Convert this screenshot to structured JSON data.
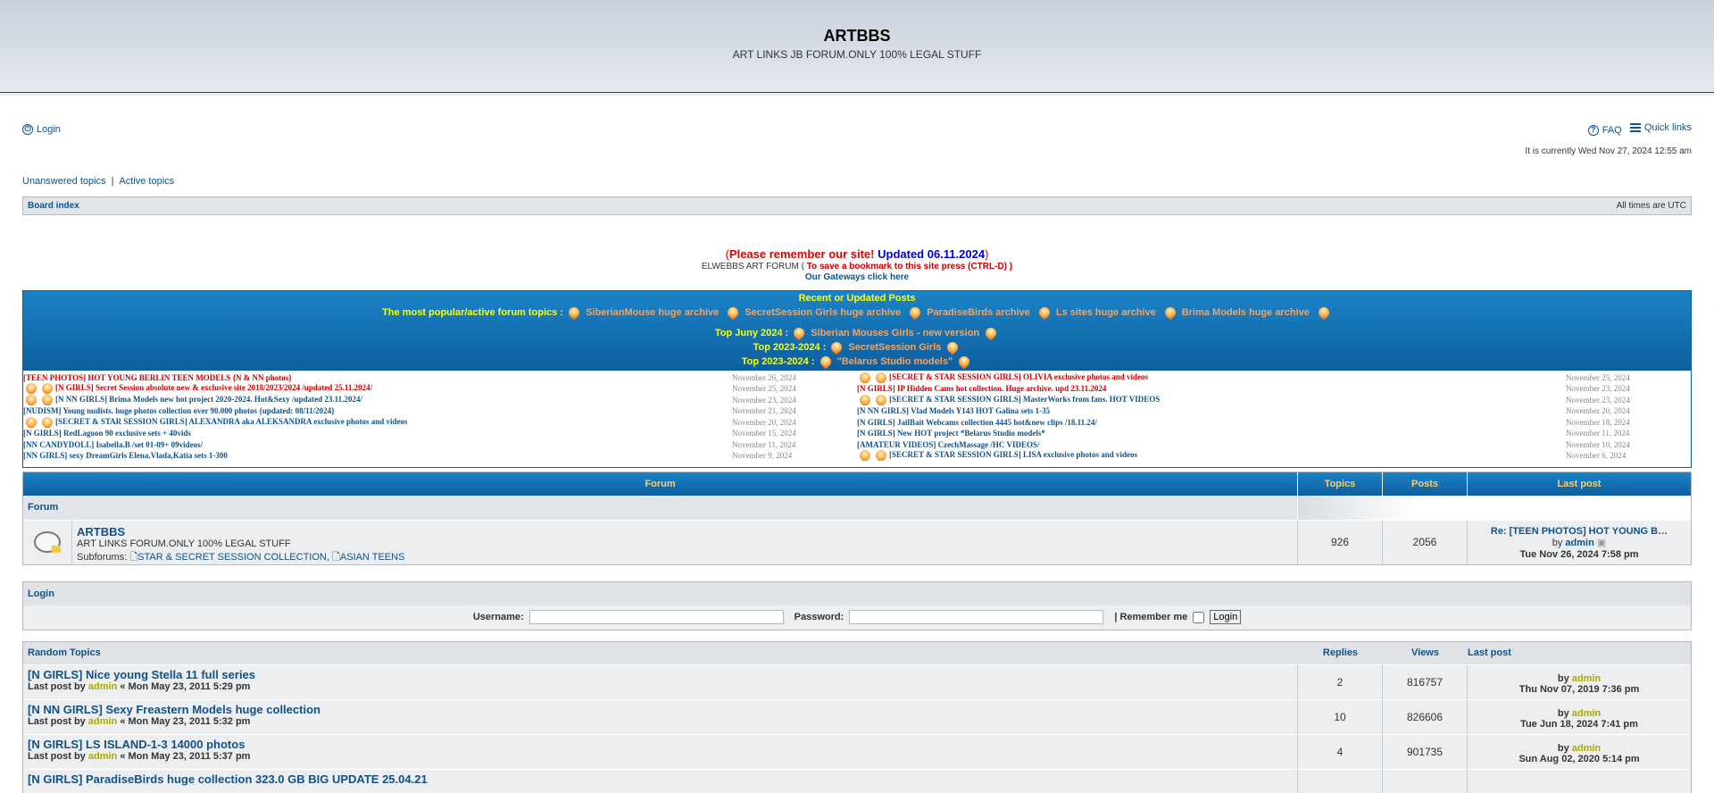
{
  "header": {
    "title": "ARTBBS",
    "subtitle": "ART LINKS JB FORUM.ONLY 100% LEGAL STUFF"
  },
  "nav": {
    "login": "Login",
    "faq": "FAQ",
    "quick_links": "Quick links"
  },
  "time_text": "It is currently Wed Nov 27, 2024 12:55 am",
  "links": {
    "unanswered": "Unanswered topics",
    "sep": "|",
    "active": "Active topics"
  },
  "breadcrumb": {
    "board_index": "Board index",
    "timezone": "All times are UTC"
  },
  "notice": {
    "open": "(",
    "remember": "Please remember our site!",
    "updated": "Updated 06.11.2024",
    "close": ")",
    "bookmark_prefix": "ELWEBBS ART FORUM (",
    "bookmark": "To save a bookmark to this site press (CTRL-D)",
    "bookmark_close": ")",
    "gateways": "Our Gateways click here"
  },
  "popular": {
    "title": "Recent or Updated Posts",
    "label": "The most popular/active forum topics :",
    "archives": [
      "SiberianMouse huge archive",
      "SecretSession Girls huge archive",
      "ParadiseBirds archive",
      "Ls sites huge archive",
      "Brima Models huge archive"
    ],
    "top1_label": "Top Juny 2024 :",
    "top1": "Siberian Mouses Girls - new version",
    "top2_label": "Top 2023-2024 :",
    "top2": "SecretSession Girls",
    "top3_label": "Top 2023-2024 :",
    "top3": "\"Belarus Studio models\""
  },
  "recent_left": [
    {
      "t": "[TEEN PHOTOS] HOT YOUNG BERLIN TEEN MODELS {N & NN photos}",
      "d": "November 26, 2024",
      "red": true
    },
    {
      "t": "[N GIRLS] Secret Session absolute new & exclusive site 2018/2023/2024 /updated 25.11.2024/",
      "d": "November 25, 2024",
      "red": true
    },
    {
      "t": "[N NN GIRLS] Brima Models new hot project 2020-2024. Hot&Sexy /updated 23.11.2024/",
      "d": "November 23, 2024",
      "red": false
    },
    {
      "t": "[NUDISM] Young nudists. huge photos collection over 90.000 photos {updated: 08/11/2024}",
      "d": "November 21, 2024",
      "red": false
    },
    {
      "t": "[SECRET & STAR SESSION GIRLS] ALEXANDRA aka ALEKSANDRA exclusive photos and videos",
      "d": "November 20, 2024",
      "red": false
    },
    {
      "t": "[N GIRLS] RedLagoon 90 exclusive sets + 40vids",
      "d": "November 15, 2024",
      "red": false
    },
    {
      "t": "[NN CANDYDOLL] Isabella.B /set 01-09+ 09videos/",
      "d": "November 11, 2024",
      "red": false
    },
    {
      "t": "[NN GIRLS] sexy DreamGirls Elena,Vlada,Katia sets 1-300",
      "d": "November 9, 2024",
      "red": false
    }
  ],
  "recent_right": [
    {
      "t": "[SECRET & STAR SESSION GIRLS] OLIVIA exclusive photos and videos",
      "d": "November 25, 2024",
      "red": true
    },
    {
      "t": "[N GIRLS] IP Hidden Cams hot collection. Huge archive. upd 23.11.2024",
      "d": "November 23, 2024",
      "red": true
    },
    {
      "t": "[SECRET & STAR SESSION GIRLS] MasterWorks from fans. HOT VIDEOS",
      "d": "November 23, 2024",
      "red": false
    },
    {
      "t": "[N NN GIRLS] Vlad Models Y143 HOT Galina sets 1-35",
      "d": "November 20, 2024",
      "red": false
    },
    {
      "t": "[N GIRLS] JailBait Webcams collection 4445 hot&new clips /18.11.24/",
      "d": "November 18, 2024",
      "red": false
    },
    {
      "t": "[N GIRLS] New HOT project *Belarus Studio models*",
      "d": "November 11, 2024",
      "red": false
    },
    {
      "t": "[AMATEUR VIDEOS] CzechMassage /HC VIDEOS/",
      "d": "November 10, 2024",
      "red": false
    },
    {
      "t": "[SECRET & STAR SESSION GIRLS] LISA exclusive photos and videos",
      "d": "November 6, 2024",
      "red": false
    }
  ],
  "forum_table": {
    "headers": {
      "forum": "Forum",
      "topics": "Topics",
      "posts": "Posts",
      "last_post": "Last post"
    },
    "section": "Forum",
    "row": {
      "name": "ARTBBS",
      "desc": "ART LINKS FORUM.ONLY 100% LEGAL STUFF",
      "sub_label": "Subforums:",
      "sub1": "STAR & SECRET SESSION COLLECTION",
      "sub_sep": ",",
      "sub2": "ASIAN TEENS",
      "topics": "926",
      "posts": "2056",
      "last_title": "Re: [TEEN PHOTOS] HOT YOUNG B…",
      "last_by": "by",
      "last_user": "admin",
      "last_date": "Tue Nov 26, 2024 7:58 pm"
    }
  },
  "login_box": {
    "title": "Login",
    "username": "Username:",
    "password": "Password:",
    "remember": "| Remember me",
    "button": "Login"
  },
  "random": {
    "headers": {
      "title": "Random Topics",
      "replies": "Replies",
      "views": "Views",
      "last_post": "Last post"
    },
    "rows": [
      {
        "title": "[N GIRLS] Nice young Stella 11 full series",
        "lp_prefix": "Last post by",
        "user": "admin",
        "date": "« Mon May 23, 2011 5:29 pm",
        "replies": "2",
        "views": "816757",
        "by": "by",
        "lp_user": "admin",
        "lp_date": "Thu Nov 07, 2019 7:36 pm"
      },
      {
        "title": "[N NN GIRLS] Sexy Freastern Models huge collection",
        "lp_prefix": "Last post by",
        "user": "admin",
        "date": "« Mon May 23, 2011 5:32 pm",
        "replies": "10",
        "views": "826606",
        "by": "by",
        "lp_user": "admin",
        "lp_date": "Tue Jun 18, 2024 7:41 pm"
      },
      {
        "title": "[N GIRLS] LS ISLAND-1-3 14000 photos",
        "lp_prefix": "Last post by",
        "user": "admin",
        "date": "« Mon May 23, 2011 5:37 pm",
        "replies": "4",
        "views": "901735",
        "by": "by",
        "lp_user": "admin",
        "lp_date": "Sun Aug 02, 2020 5:14 pm"
      },
      {
        "title": "[N GIRLS] ParadiseBirds huge collection 323.0 GB BIG UPDATE 25.04.21",
        "lp_prefix": "",
        "user": "",
        "date": "",
        "replies": "",
        "views": "",
        "by": "",
        "lp_user": "",
        "lp_date": ""
      }
    ]
  },
  "colors": {
    "accent": "#105289",
    "band": "#0e5f9e",
    "admin": "#aa0"
  }
}
